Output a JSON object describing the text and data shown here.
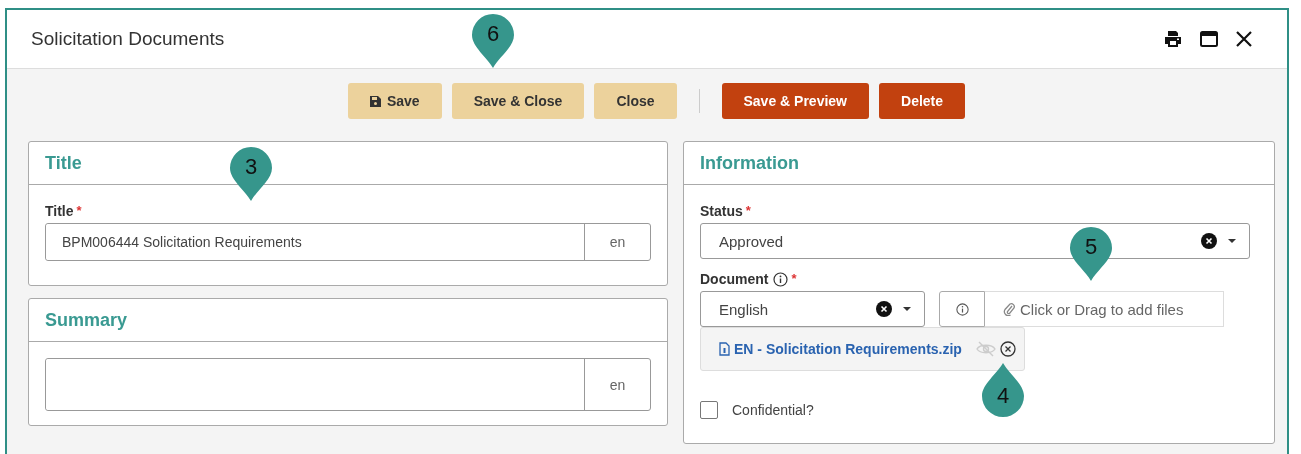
{
  "window": {
    "title": "Solicitation Documents"
  },
  "toolbar": [
    {
      "label": "Save",
      "kind": "save"
    },
    {
      "label": "Save & Close",
      "kind": "neutral"
    },
    {
      "label": "Close",
      "kind": "neutral"
    },
    {
      "kind": "separator"
    },
    {
      "label": "Save & Preview",
      "kind": "danger"
    },
    {
      "label": "Delete",
      "kind": "danger"
    }
  ],
  "title_panel": {
    "heading": "Title",
    "field": {
      "label": "Title",
      "required_mark": "*",
      "value": "BPM006444 Solicitation Requirements",
      "lang": "en"
    }
  },
  "summary_panel": {
    "heading": "Summary",
    "field": {
      "lang": "en"
    }
  },
  "information_panel": {
    "heading": "Information",
    "status": {
      "label": "Status",
      "required_mark": "*",
      "value": "Approved"
    },
    "document": {
      "label": "Document",
      "required_mark": "*",
      "language": "English",
      "upload_placeholder": "Click or Drag to add files",
      "files": [
        {
          "name": "EN - Solicitation Requirements.zip",
          "visible": false
        }
      ]
    },
    "confidential": {
      "label": "Confidential?",
      "checked": false
    }
  },
  "callouts": [
    {
      "number": "6",
      "kind": "down"
    },
    {
      "number": "3",
      "kind": "down"
    },
    {
      "number": "5",
      "kind": "down"
    },
    {
      "number": "4",
      "kind": "up"
    }
  ]
}
